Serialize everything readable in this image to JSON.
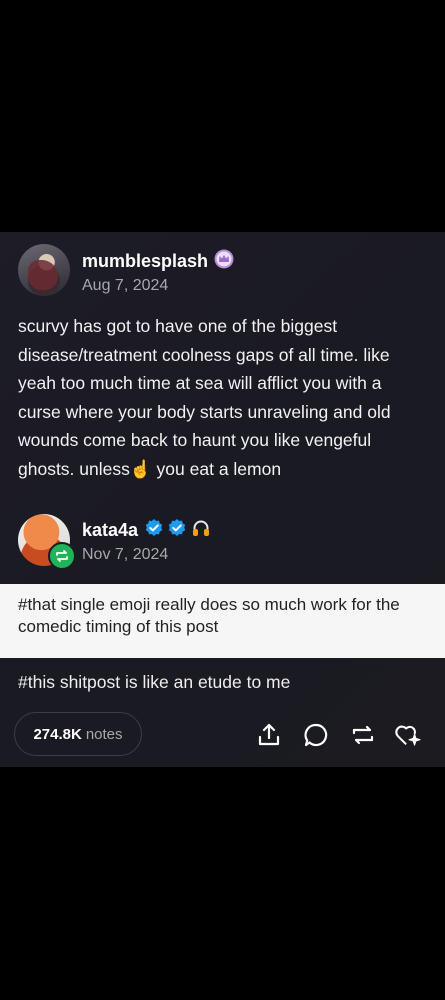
{
  "post": {
    "author": "mumblesplash",
    "date": "Aug 7, 2024",
    "body_before_emoji": "scurvy has got to have one of the biggest disease/treatment coolness gaps of all time. like yeah too much time at sea will afflict you with a curse where your body starts unraveling and old wounds come back to haunt you like vengeful ghosts. unless",
    "emoji": "☝️",
    "body_after_emoji": "you eat a lemon"
  },
  "reblog": {
    "author": "kata4a",
    "date": "Nov 7, 2024",
    "badges": [
      "verified-icon",
      "verified-icon",
      "headphones-icon"
    ],
    "tag_highlight": "#that single emoji really does so much work for the comedic timing of this post",
    "tag_2": "#this shitpost is like an etude to me"
  },
  "footer": {
    "notes_count": "274.8K",
    "notes_label": "notes",
    "actions": [
      "share-icon",
      "reply-icon",
      "reblog-icon",
      "like-icon"
    ]
  },
  "colors": {
    "card_bg": "#1b1b22",
    "text_muted": "#a7a7ad",
    "verified_blue": "#1d9bf0",
    "reblog_green": "#1fb35a",
    "highlight_bg": "#f6f6f6"
  }
}
